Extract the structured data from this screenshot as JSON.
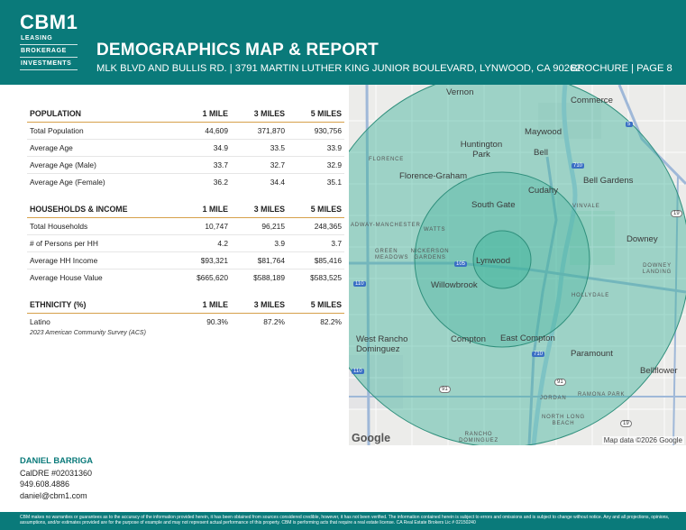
{
  "brand": {
    "logo": "CBM1",
    "lines": [
      "LEASING",
      "BROKERAGE",
      "INVESTMENTS"
    ]
  },
  "header": {
    "title": "DEMOGRAPHICS MAP & REPORT",
    "subtitle": "MLK BLVD AND BULLIS RD. | 3791 MARTIN LUTHER KING JUNIOR BOULEVARD, LYNWOOD, CA 90262",
    "brochure": "BROCHURE | PAGE 8"
  },
  "colors": {
    "primary": "#0a7a7a",
    "rule": "#d6a04a",
    "ring": "#3fb39c"
  },
  "population": {
    "header": [
      "POPULATION",
      "1 MILE",
      "3 MILES",
      "5 MILES"
    ],
    "rows": [
      [
        "Total Population",
        "44,609",
        "371,870",
        "930,756"
      ],
      [
        "Average Age",
        "34.9",
        "33.5",
        "33.9"
      ],
      [
        "Average Age (Male)",
        "33.7",
        "32.7",
        "32.9"
      ],
      [
        "Average Age (Female)",
        "36.2",
        "34.4",
        "35.1"
      ]
    ]
  },
  "households": {
    "header": [
      "HOUSEHOLDS & INCOME",
      "1 MILE",
      "3 MILES",
      "5 MILES"
    ],
    "rows": [
      [
        "Total Households",
        "10,747",
        "96,215",
        "248,365"
      ],
      [
        "# of Persons per HH",
        "4.2",
        "3.9",
        "3.7"
      ],
      [
        "Average HH Income",
        "$93,321",
        "$81,764",
        "$85,416"
      ],
      [
        "Average House Value",
        "$665,620",
        "$588,189",
        "$583,525"
      ]
    ]
  },
  "ethnicity": {
    "header": [
      "ETHNICITY (%)",
      "1 MILE",
      "3 MILES",
      "5 MILES"
    ],
    "rows": [
      [
        "Latino",
        "90.3%",
        "87.2%",
        "82.2%"
      ]
    ],
    "source": "2023 American Community Survey (ACS)"
  },
  "map": {
    "cities": [
      "Vernon",
      "Commerce",
      "Maywood",
      "Huntington Park",
      "Bell",
      "Florence-Graham",
      "Cudahy",
      "Bell Gardens",
      "South Gate",
      "Downey",
      "Lynwood",
      "Willowbrook",
      "West Rancho Dominguez",
      "Compton",
      "East Compton",
      "Paramount",
      "Bellflower"
    ],
    "small_labels": [
      "FLORENCE",
      "ADWAY-MANCHESTER",
      "WATTS",
      "GREEN MEADOWS",
      "NICKERSON GARDENS",
      "VINVALE",
      "DOWNEY LANDING",
      "HOLLYDALE",
      "JORDAN",
      "RAMONA PARK",
      "NORTH LONG BEACH",
      "RANCHO DOMINGUEZ"
    ],
    "shields": [
      "5",
      "710",
      "19",
      "105",
      "110",
      "110",
      "710",
      "91",
      "91",
      "19"
    ],
    "google": "Google",
    "attribution": "Map data ©2026 Google"
  },
  "contact": {
    "name": "DANIEL BARRIGA",
    "license": "CalDRE #02031360",
    "phone": "949.608.4886",
    "email": "daniel@cbm1.com"
  },
  "footer": {
    "disclaimer": "CBM makes no warranties or guarantees as to the accuracy of the information provided herein, it has been obtained from sources considered credible, however, it has not been verified. The information contained herein is subject to errors and omissions and is subject to change without notice. Any and all projections, opinions, assumptions, and/or estimates provided are for the purpose of example and may not represent actual performance of this property. CBM is performing acts that require a real estate license. CA Real Estate Brokers Lic # 02150240"
  }
}
